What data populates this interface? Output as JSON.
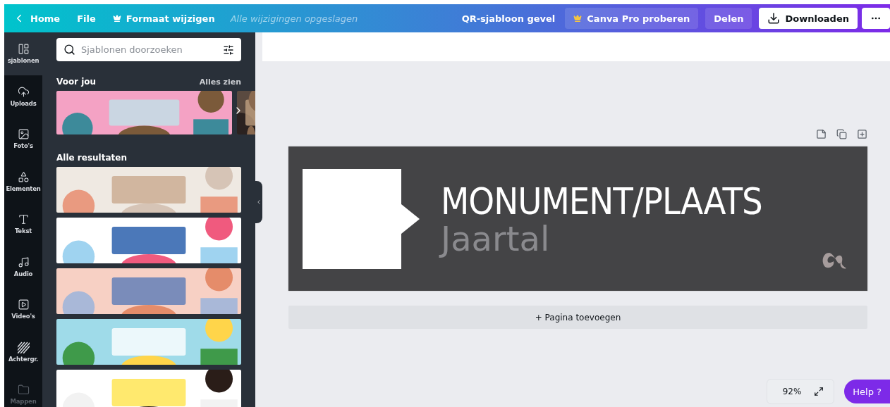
{
  "topbar": {
    "back": "Home",
    "file": "File",
    "resize": "Formaat wijzigen",
    "status": "Alle wijzigingen opgeslagen",
    "title": "QR-sjabloon gevel",
    "pro": "Canva Pro proberen",
    "share": "Delen",
    "download": "Downloaden"
  },
  "rail": [
    {
      "kind": "templates",
      "label": "sjablonen",
      "selected": true,
      "disabled": false
    },
    {
      "kind": "uploads",
      "label": "Uploads",
      "selected": false,
      "disabled": false
    },
    {
      "kind": "photos",
      "label": "Foto's",
      "selected": false,
      "disabled": false
    },
    {
      "kind": "elements",
      "label": "Elementen",
      "selected": false,
      "disabled": false
    },
    {
      "kind": "text",
      "label": "Tekst",
      "selected": false,
      "disabled": false
    },
    {
      "kind": "audio",
      "label": "Audio",
      "selected": false,
      "disabled": false
    },
    {
      "kind": "video",
      "label": "Video's",
      "selected": false,
      "disabled": false
    },
    {
      "kind": "background",
      "label": "Achtergr.",
      "selected": false,
      "disabled": false
    },
    {
      "kind": "folders",
      "label": "Mappen",
      "selected": false,
      "disabled": true
    }
  ],
  "panel": {
    "search": {
      "placeholder": "Sjablonen doorzoeken"
    },
    "for_you": {
      "title": "Voor jou",
      "link": "Alles zien"
    },
    "results": {
      "title": "Alle resultaten"
    }
  },
  "design": {
    "heading": "MONUMENT/PLAATS",
    "subheading": "Jaartal",
    "add_page": "+ Pagina toevoegen"
  },
  "footer": {
    "zoom": "92%",
    "help": "Help ?"
  }
}
